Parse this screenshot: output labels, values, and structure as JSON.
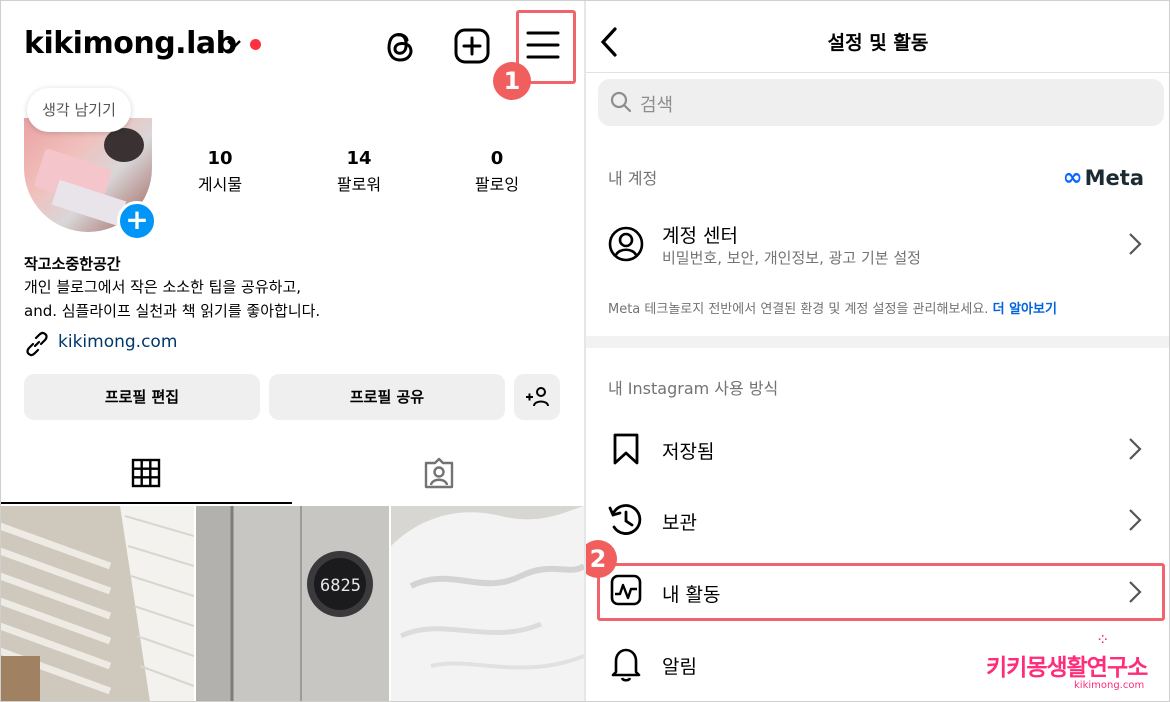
{
  "profile": {
    "username": "kikimong.lab",
    "note_bubble": "생각 남기기",
    "stats": [
      {
        "value": "10",
        "label": "게시물"
      },
      {
        "value": "14",
        "label": "팔로워"
      },
      {
        "value": "0",
        "label": "팔로잉"
      }
    ],
    "name": "작고소중한공간",
    "bio": [
      "개인 블로그에서 작은 소소한 팁을 공유하고,",
      "and. 심플라이프 실천과 책 읽기를 좋아합니다."
    ],
    "link": "kikimong.com",
    "buttons": {
      "edit": "프로필 편집",
      "share": "프로필 공유",
      "add_person": "+⁠8"
    },
    "icons": [
      "threads-icon",
      "new-post-icon",
      "menu-icon",
      "grid-icon",
      "tagged-icon"
    ]
  },
  "annotations": {
    "step1": "1",
    "step2": "2",
    "color": "#f05e5e"
  },
  "settings": {
    "title": "설정 및 활동",
    "search_placeholder": "검색",
    "account_section": "내 계정",
    "meta_logo": "Meta",
    "account_center": {
      "title": "계정 센터",
      "subtitle": "비밀번호, 보안, 개인정보, 광고 기본 설정"
    },
    "meta_note": "Meta 테크놀로지 전반에서 연결된 환경 및 계정 설정을 관리해보세요.",
    "meta_note_link": "더 알아보기",
    "usage_section": "내 Instagram 사용 방식",
    "items": [
      {
        "label": "저장됨",
        "icon": "bookmark-icon"
      },
      {
        "label": "보관",
        "icon": "archive-icon"
      },
      {
        "label": "내 활동",
        "icon": "activity-icon"
      },
      {
        "label": "알림",
        "icon": "bell-icon"
      }
    ]
  },
  "watermark": {
    "main": "키키몽생활연구소",
    "sub": "kikimong.com"
  }
}
